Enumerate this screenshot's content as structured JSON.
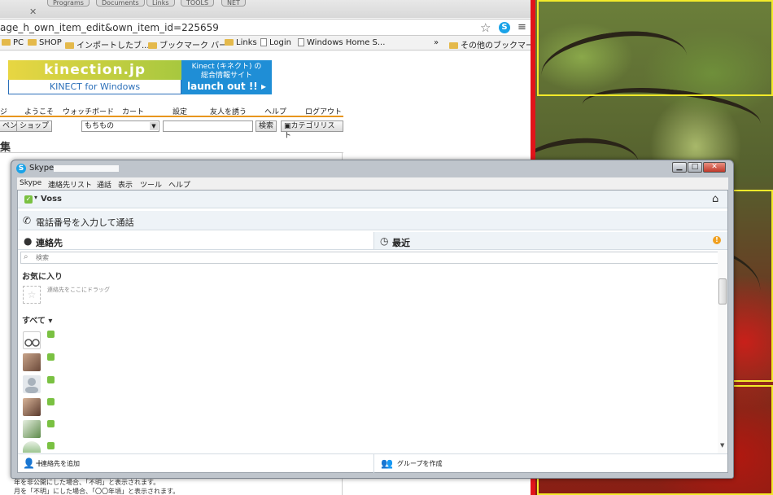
{
  "browser": {
    "menu_pills": [
      "Programs",
      "Documents",
      "Links",
      "TOOLS",
      "NET"
    ],
    "url": "age_h_own_item_edit&own_item_id=225659",
    "bookmarks": [
      "PC",
      "SHOP",
      "インポートしたブ...",
      "ブックマーク バー",
      "Links",
      "Login",
      "Windows Home S...",
      "その他のブックマーク"
    ],
    "bookmarks_more": "»"
  },
  "webpage": {
    "logo_top": "kinection.jp",
    "logo_bottom": "KINECT for Windows",
    "ad_line1": "Kinect (キネクト) の",
    "ad_line2": "総合情報サイト",
    "ad_line3": "launch out !! ▸",
    "nav": [
      "ジ",
      "ようこそ",
      "ウォッチボード",
      "カート",
      "設定",
      "友人を誘う",
      "ヘルプ",
      "ログアウト"
    ],
    "search_btn_left": "ペン",
    "search_btn_shop": "ショップ",
    "search_select": "もちもの",
    "search_submit": "検索",
    "category_list": "カテゴリリスト",
    "heading": "集",
    "foot_line1": "年を非公開にした場合、「不明」と表示されます。",
    "foot_line2": "月を「不明」にした場合、「〇〇年頃」と表示されます。"
  },
  "skype": {
    "title": "Skype",
    "title_extra": "[0]",
    "win_min": "▁",
    "win_max": "□",
    "win_close": "✕",
    "menu": [
      "Skype",
      "連絡先リスト",
      "通話",
      "表示",
      "ツール",
      "ヘルプ"
    ],
    "user_name": "Voss",
    "call_label": "電話番号を入力して通話",
    "tab_contacts": "連絡先",
    "tab_recent": "最近",
    "search_placeholder": "検索",
    "favorites_heading": "お気に入り",
    "favorites_hint": "連絡先をここにドラッグ",
    "all_heading": "すべて ▾",
    "add_contact": "連絡先を追加",
    "create_group": "グループを作成"
  },
  "colors": {
    "skype_blue": "#1aa3e8",
    "online_green": "#7ac142",
    "alert_orange": "#f0a020",
    "annotation_red": "#e1141a",
    "annotation_yellow": "#f2ea2a"
  }
}
